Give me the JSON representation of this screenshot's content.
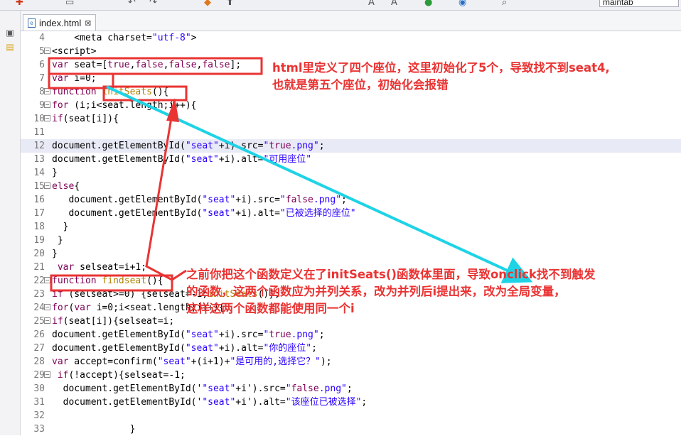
{
  "toolbar": {
    "search_text": "maintab"
  },
  "tab": {
    "title": "index.html"
  },
  "lines": [
    {
      "n": "4",
      "fold": "",
      "code": "    <meta charset=\"utf-8\">"
    },
    {
      "n": "5",
      "fold": "−",
      "code": "<script>"
    },
    {
      "n": "6",
      "fold": "",
      "code": "var seat=[true,false,false,false];"
    },
    {
      "n": "7",
      "fold": "",
      "code": "var i=0;"
    },
    {
      "n": "8",
      "fold": "−",
      "code": "function initSeats(){"
    },
    {
      "n": "9",
      "fold": "−",
      "code": "for (i;i<seat.length;i++){"
    },
    {
      "n": "10",
      "fold": "−",
      "code": "if(seat[i]){"
    },
    {
      "n": "11",
      "fold": "",
      "code": ""
    },
    {
      "n": "12",
      "fold": "",
      "code": "document.getElementById(\"seat\"+i).src=\"true.png\";",
      "hl": true
    },
    {
      "n": "13",
      "fold": "",
      "code": "document.getElementById(\"seat\"+i).alt=\"可用座位\""
    },
    {
      "n": "14",
      "fold": "",
      "code": "}"
    },
    {
      "n": "15",
      "fold": "−",
      "code": "else{"
    },
    {
      "n": "16",
      "fold": "",
      "code": "   document.getElementById(\"seat\"+i).src=\"false.png\";"
    },
    {
      "n": "17",
      "fold": "",
      "code": "   document.getElementById(\"seat\"+i).alt=\"已被选择的座位\""
    },
    {
      "n": "18",
      "fold": "",
      "code": "  }"
    },
    {
      "n": "19",
      "fold": "",
      "code": " }"
    },
    {
      "n": "20",
      "fold": "",
      "code": "}"
    },
    {
      "n": "21",
      "fold": "",
      "code": " var selseat=i+1;"
    },
    {
      "n": "22",
      "fold": "−",
      "code": "function findseat(){"
    },
    {
      "n": "23",
      "fold": "",
      "code": "if (selseat>=0) {selseat=-1;initSeats()};"
    },
    {
      "n": "24",
      "fold": "−",
      "code": "for(var i=0;i<seat.length;i++){"
    },
    {
      "n": "25",
      "fold": "−",
      "code": "if(seat[i]){selseat=i;"
    },
    {
      "n": "26",
      "fold": "",
      "code": "document.getElementById(\"seat\"+i).src=\"true.png\";"
    },
    {
      "n": "27",
      "fold": "",
      "code": "document.getElementById(\"seat\"+i).alt=\"你的座位\";"
    },
    {
      "n": "28",
      "fold": "",
      "code": "var accept=confirm(\"seat\"+(i+1)+\"是可用的,选择它？\");"
    },
    {
      "n": "29",
      "fold": "−",
      "code": " if(!accept){selseat=-1;"
    },
    {
      "n": "30",
      "fold": "",
      "code": "  document.getElementById('\"seat\"+i').src=\"false.png\";"
    },
    {
      "n": "31",
      "fold": "",
      "code": "  document.getElementById('\"seat\"+i').alt=\"该座位已被选择\";"
    },
    {
      "n": "32",
      "fold": "",
      "code": ""
    },
    {
      "n": "33",
      "fold": "",
      "code": "              }"
    }
  ],
  "annotations": {
    "top_line1": "html里定义了四个座位，这里初始化了5个，导致找不到seat4,",
    "top_line2": "也就是第五个座位，初始化会报错",
    "bottom_line1": "之前你把这个函数定义在了initSeats()函数体里面，导致onclick找不到触发",
    "bottom_line2": "的函数，这两个函数应为并列关系，改为并列后i提出来，改为全局变量，",
    "bottom_line3": "这样这两个函数都能使用同一个i"
  },
  "colors": {
    "annotation": "#ea3333",
    "arrow_cyan": "#1ed3e6",
    "line_highlight": "#e8eaf6"
  },
  "icons": [
    "new-icon",
    "undo-icon",
    "redo-icon",
    "bookmark-icon",
    "font-size-icon",
    "run-icon",
    "browser-icon",
    "search-icon",
    "package-icon",
    "folder-icon",
    "file-icon",
    "close-icon"
  ]
}
